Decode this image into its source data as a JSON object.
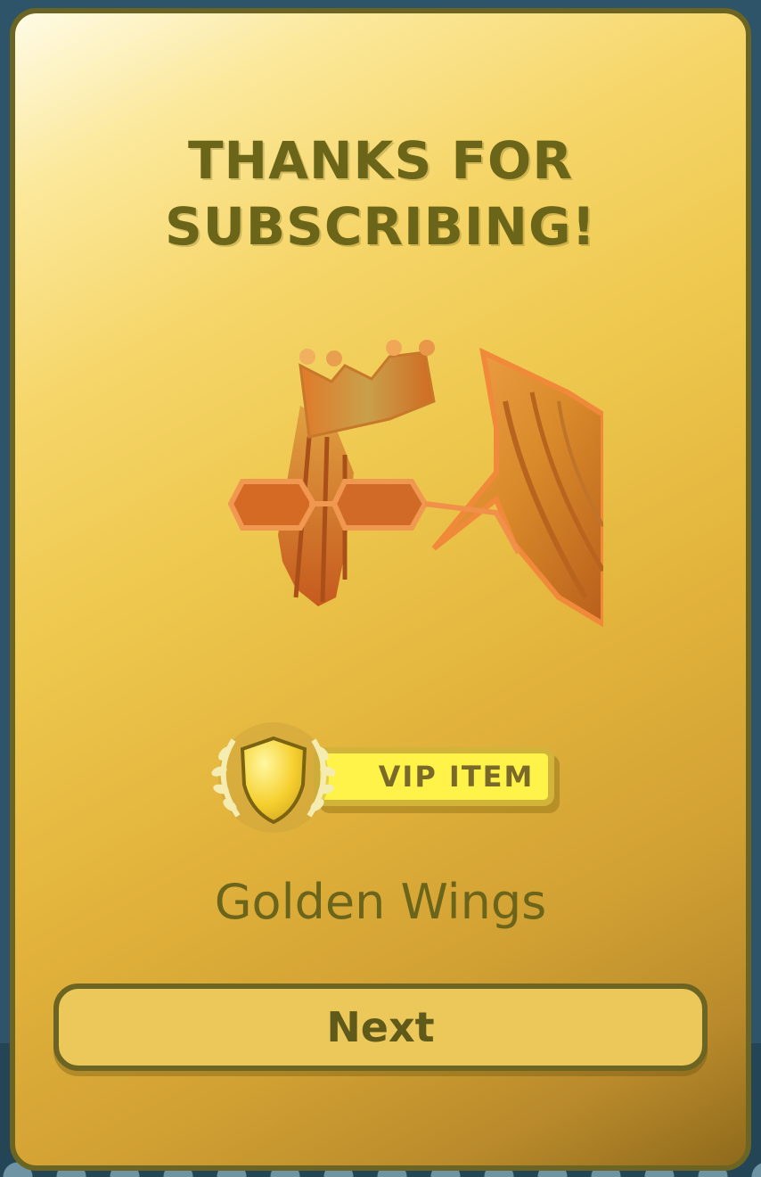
{
  "dialog": {
    "title_line1": "THANKS FOR",
    "title_line2": "SUBSCRIBING!",
    "item_image_icon": "golden-wings-icon",
    "badge": {
      "label": "VIP ITEM",
      "icon": "shield-laurel-icon"
    },
    "item_name": "Golden Wings",
    "next_label": "Next"
  },
  "colors": {
    "border": "#6b6422",
    "title_text": "#6b6519",
    "badge_fill": "#fff34a",
    "button_fill": "#ecc85a",
    "backdrop": "#2d5468"
  }
}
